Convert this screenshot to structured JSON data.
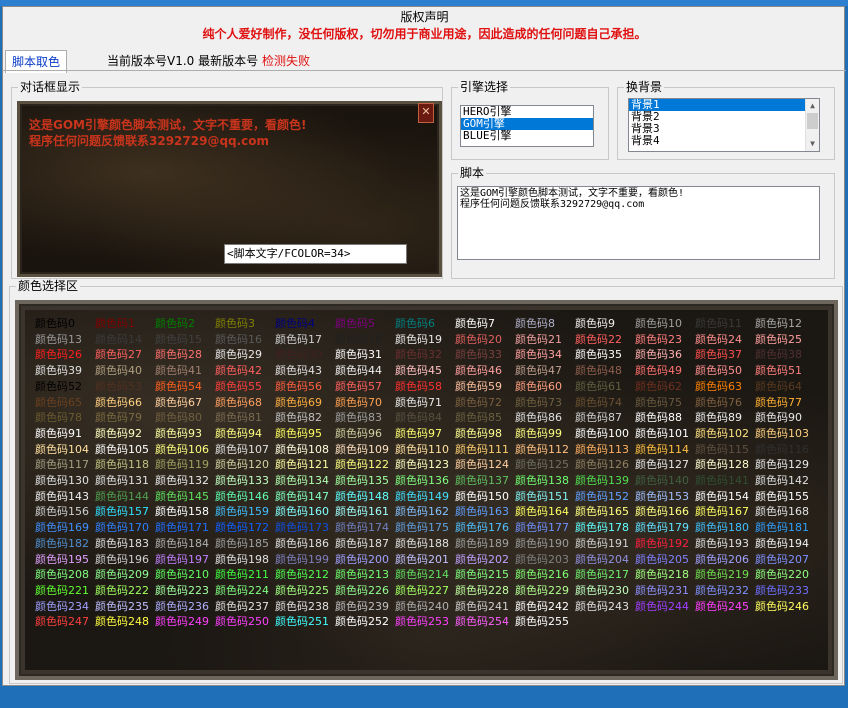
{
  "copyright": {
    "title": "版权声明",
    "text": "纯个人爱好制作，没任何版权，切勿用于商业用途，因此造成的任何问题自己承担。"
  },
  "tab": {
    "label": "脚本取色"
  },
  "version": {
    "current": "当前版本号V1.0 最新版本号",
    "status": "检测失败"
  },
  "dialog_group": {
    "label": "对话框显示",
    "preview_line1": "这是GOM引擎颜色脚本测试，文字不重要，看颜色!",
    "preview_line2": "程序任何问题反馈联系3292729@qq.com",
    "close_icon": "✕",
    "input_value": "<脚本文字/FCOLOR=34>"
  },
  "engine_group": {
    "label": "引擎选择",
    "items": [
      "HERO引擎",
      "GOM引擎",
      "BLUE引擎"
    ],
    "selected": 1
  },
  "bg_group": {
    "label": "换背景",
    "items": [
      "背景1",
      "背景2",
      "背景3",
      "背景4"
    ],
    "selected": 0
  },
  "script_group": {
    "label": "脚本",
    "text": "这是GOM引擎颜色脚本测试，文字不重要，看颜色!\n程序任何问题反馈联系3292729@qq.com"
  },
  "palette_group": {
    "label": "颜色选择区",
    "prefix": "颜色码",
    "colors": [
      "#000000",
      "#800000",
      "#008000",
      "#808000",
      "#000080",
      "#800080",
      "#008080",
      "#ffffff",
      "#b0b0c8",
      "#f0f0f0",
      "#a0a0a0",
      "#3a3a3a",
      "#a8a8a8",
      "#9a9a9a",
      "#3a3a3a",
      "#404040",
      "#5a5a5a",
      "#d0d0d0",
      "#202020",
      "#e8e8e8",
      "#e06060",
      "#f0a0a0",
      "#ff6060",
      "#ff8080",
      "#ff9090",
      "#ffa0a0",
      "#ff2020",
      "#ff6060",
      "#ff7070",
      "#e8e8e8",
      "#402020",
      "#ffffff",
      "#6a3030",
      "#7a4040",
      "#ffa0a0",
      "#ffffff",
      "#ffb0b0",
      "#ff5050",
      "#503030",
      "#e0e0e0",
      "#b0a080",
      "#a08070",
      "#ff6060",
      "#e0e0e0",
      "#f0f0f0",
      "#ffc0c0",
      "#ffa0a0",
      "#c0a090",
      "#906050",
      "#ff7070",
      "#ff9090",
      "#ff8080",
      "#000000",
      "#503020",
      "#ff6020",
      "#ff4040",
      "#ff6040",
      "#ff6060",
      "#ff3030",
      "#ffc0a0",
      "#ffa080",
      "#606040",
      "#703020",
      "#ff8000",
      "#5a3a20",
      "#6a4020",
      "#ffd080",
      "#ffd0a0",
      "#ffa060",
      "#ffb040",
      "#ffa050",
      "#e8e8e8",
      "#7a6040",
      "#706040",
      "#6a5030",
      "#6a5a40",
      "#806040",
      "#ffb030",
      "#6a5a30",
      "#7a6a40",
      "#706040",
      "#7a6a50",
      "#c0c0c0",
      "#a0a0a0",
      "#5a5040",
      "#6a6040",
      "#e0e0e0",
      "#d0d0d0",
      "#ffffff",
      "#f0f0f0",
      "#e8e8e8",
      "#ffffff",
      "#ffffc0",
      "#ffffa0",
      "#ffff80",
      "#ffff60",
      "#d0d0a0",
      "#ffff70",
      "#ffff90",
      "#ffff80",
      "#ffffff",
      "#ffffff",
      "#ffe080",
      "#ffd080",
      "#ffe0a0",
      "#ffffff",
      "#ffff80",
      "#e0e0e0",
      "#ffffe0",
      "#ffe0c0",
      "#ffe0a0",
      "#ffd070",
      "#ffc080",
      "#ffb060",
      "#ffc040",
      "#605040",
      "#303030",
      "#a0a080",
      "#c0c080",
      "#a0a060",
      "#d0d0a0",
      "#ffffa0",
      "#ffff80",
      "#ffffc0",
      "#ffd0a0",
      "#707060",
      "#908060",
      "#e8e8e8",
      "#ffffd0",
      "#e8e8e8",
      "#e0e0e0",
      "#e0e0e0",
      "#e8e8e8",
      "#c0ffc0",
      "#b0ffb0",
      "#a0ffa0",
      "#80ff80",
      "#60c060",
      "#70ff70",
      "#50e050",
      "#406040",
      "#305030",
      "#e0e0e0",
      "#f0f0f0",
      "#50a050",
      "#60e060",
      "#60ffb0",
      "#80ffc0",
      "#60ffff",
      "#40e0ff",
      "#ffffff",
      "#80f0f0",
      "#60a0ff",
      "#a0c0ff",
      "#ffffff",
      "#ffffff",
      "#d0d0d0",
      "#30e0ff",
      "#ffffff",
      "#40c0ff",
      "#80ffff",
      "#a0ffff",
      "#80c0ff",
      "#60a0ff",
      "#ffff60",
      "#ffff80",
      "#ffff80",
      "#ffff60",
      "#e0e0e0",
      "#4090ff",
      "#3080ff",
      "#2070ff",
      "#1060ff",
      "#1050e0",
      "#7080c0",
      "#60a0e0",
      "#50c0ff",
      "#7090ff",
      "#60ffff",
      "#60e0ff",
      "#40c0ff",
      "#30a0ff",
      "#5090d0",
      "#e0e0e0",
      "#b0b0b0",
      "#a0a0a0",
      "#e0e0e0",
      "#e0e0e0",
      "#e0e0e0",
      "#a0a0a0",
      "#9a9a9a",
      "#d0d0d0",
      "#ff2040",
      "#e0e0e0",
      "#f0f0f0",
      "#e0a0ff",
      "#d0d0d0",
      "#c080ff",
      "#e0e0e0",
      "#8080c0",
      "#a0a0ff",
      "#c0c0ff",
      "#c0a0ff",
      "#808080",
      "#9090e0",
      "#8080ff",
      "#a0a0ff",
      "#8090ff",
      "#80ff80",
      "#90ff90",
      "#60ff60",
      "#40ff40",
      "#50ff50",
      "#70ff70",
      "#60e060",
      "#80ff80",
      "#80ff70",
      "#70f070",
      "#a0ff80",
      "#70e050",
      "#90ff80",
      "#60ff30",
      "#a0ff60",
      "#a0ffa0",
      "#80ff80",
      "#a0ff80",
      "#90ff90",
      "#a0ff60",
      "#c0ffa0",
      "#b0ff90",
      "#c0ffc0",
      "#9090ff",
      "#8090ff",
      "#7070ff",
      "#a0a0ff",
      "#c0c0ff",
      "#b0b0ff",
      "#e0e0e0",
      "#e0e0e0",
      "#c0c0c0",
      "#b0b0b0",
      "#d0d0d0",
      "#ffffff",
      "#e0e0e0",
      "#a040ff",
      "#ff40ff",
      "#ffff60",
      "#ff4040",
      "#ffff40",
      "#ff40ff",
      "#ff40ff",
      "#40ffff",
      "#ffffff",
      "#ff40ff",
      "#ff60ff",
      "#ffffff"
    ]
  }
}
